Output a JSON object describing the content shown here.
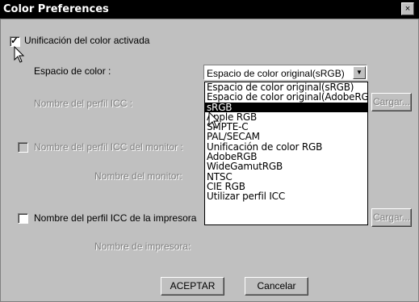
{
  "window": {
    "title": "Color Preferences",
    "close_label": "×"
  },
  "color_sync": {
    "label": "Unificación del color activada",
    "checked": true
  },
  "color_space": {
    "label": "Espacio de color :",
    "selected": "Espacio de color original(sRGB)"
  },
  "icc_profile": {
    "label": "Nombre del perfil ICC :",
    "load_label": "Cargar..."
  },
  "monitor_profile": {
    "label": "Nombre del perfil ICC del monitor :",
    "name_label": "Nombre del monitor:"
  },
  "printer_profile": {
    "label": "Nombre del perfil ICC de la impresora",
    "load_label": "Cargar...",
    "name_label": "Nombre de impresora:"
  },
  "dropdown": {
    "options": [
      "Espacio de color original(sRGB)",
      "Espacio de color original(AdobeRGB)",
      "sRGB",
      "Apple RGB",
      "SMPTE-C",
      "PAL/SECAM",
      "Unificación de color RGB",
      "AdobeRGB",
      "WideGamutRGB",
      "NTSC",
      "CIE RGB",
      "Utilizar perfil ICC"
    ],
    "highlighted_index": 2
  },
  "buttons": {
    "ok": "ACEPTAR",
    "cancel": "Cancelar"
  }
}
